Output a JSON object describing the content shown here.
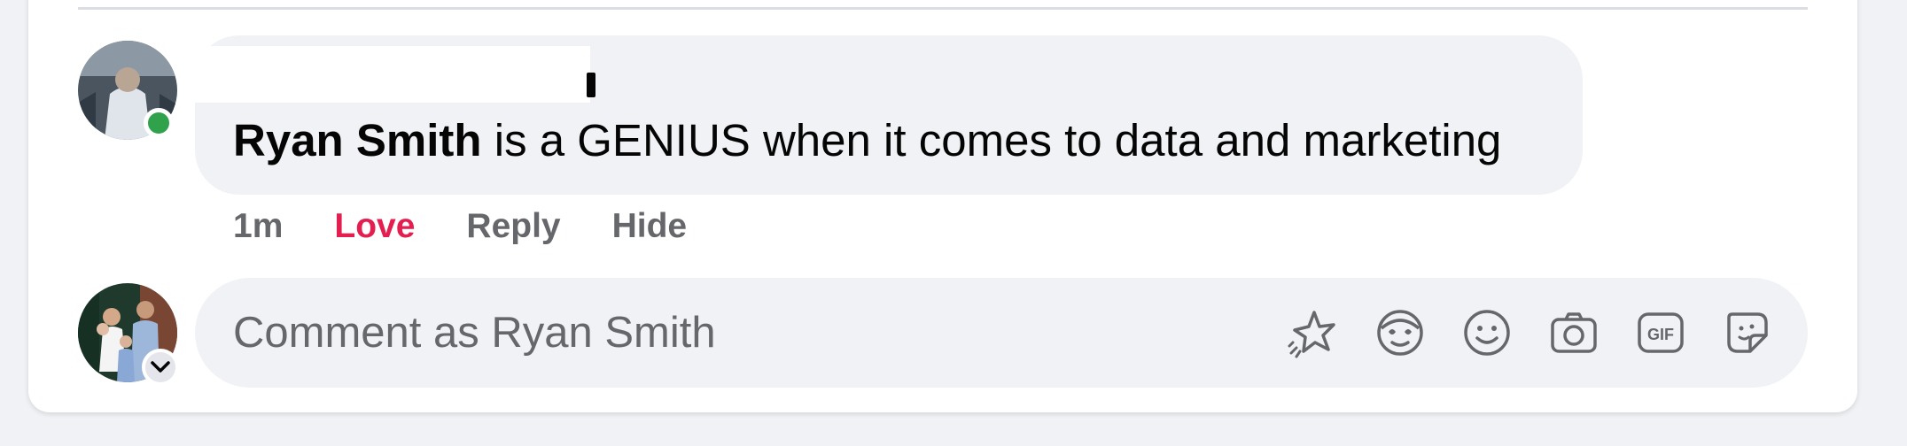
{
  "comment": {
    "mention": "Ryan Smith",
    "text": " is a GENIUS when it comes to data and marketing",
    "time": "1m",
    "reaction_label": "Love",
    "reply_label": "Reply",
    "hide_label": "Hide"
  },
  "composer": {
    "placeholder": "Comment as Ryan Smith",
    "icons": [
      "avatar-sticker-icon",
      "emoji-face-icon",
      "smiley-icon",
      "camera-icon",
      "gif-icon",
      "sticker-icon"
    ]
  },
  "colors": {
    "love": "#e41e4f",
    "online": "#31a24c",
    "muted_text": "#65676b",
    "bubble_bg": "#f0f2f5"
  }
}
